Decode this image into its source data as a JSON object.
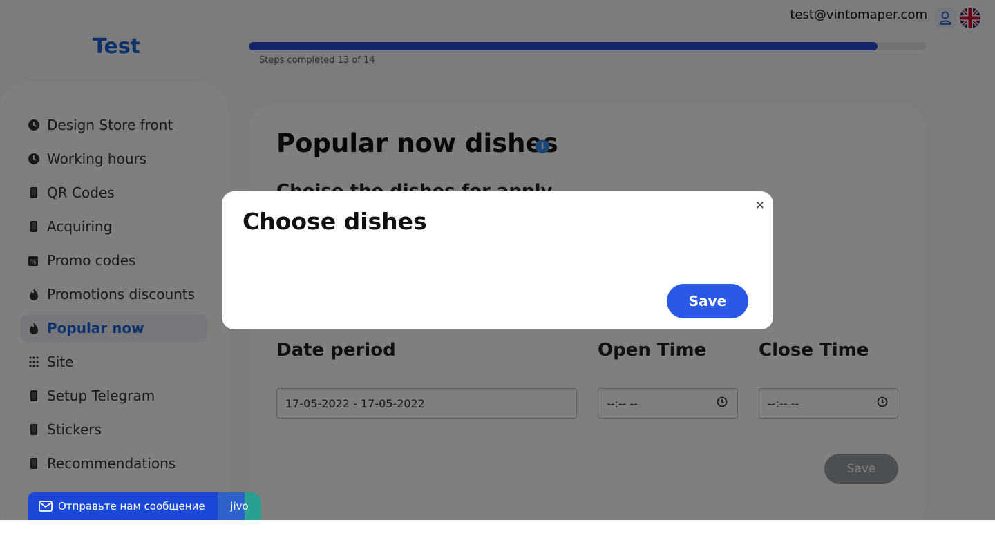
{
  "header": {
    "brand": "Test",
    "user_email": "test@vintomaper.com",
    "progress_label": "Steps completed 13 of 14",
    "progress": {
      "completed": 13,
      "total": 14
    }
  },
  "sidebar": {
    "items": [
      {
        "label": "Design Store front",
        "icon": "clock-icon"
      },
      {
        "label": "Working hours",
        "icon": "clock-icon"
      },
      {
        "label": "QR Codes",
        "icon": "phone-icon"
      },
      {
        "label": "Acquiring",
        "icon": "phone-icon"
      },
      {
        "label": "Promo codes",
        "icon": "percent-tag-icon"
      },
      {
        "label": "Promotions discounts",
        "icon": "flame-icon"
      },
      {
        "label": "Popular now",
        "icon": "flame-icon",
        "active": true
      },
      {
        "label": "Site",
        "icon": "grid-dots-icon"
      },
      {
        "label": "Setup Telegram",
        "icon": "phone-icon"
      },
      {
        "label": "Stickers",
        "icon": "phone-icon"
      },
      {
        "label": "Recommendations",
        "icon": "phone-icon"
      }
    ]
  },
  "main": {
    "title": "Popular now dishes",
    "info_icon": "i",
    "subtitle": "Choise the dishes for apply",
    "date_period_label": "Date period",
    "date_period_value": "17-05-2022 - 17-05-2022",
    "open_time_label": "Open Time",
    "open_time_value": "--:-- --",
    "close_time_label": "Close Time",
    "close_time_value": "--:-- --",
    "save_label": "Save"
  },
  "modal": {
    "title": "Choose dishes",
    "close_label": "×",
    "save_label": "Save"
  },
  "chat_widget": {
    "label": "Отправьте нам сообщение",
    "brand": "jivo"
  },
  "colors": {
    "accent": "#2a59e6",
    "brand": "#1b63d8",
    "progress": "#2a4bd9",
    "overlay": "rgba(0,0,0,0.5)",
    "chat": "#1d47d6"
  }
}
